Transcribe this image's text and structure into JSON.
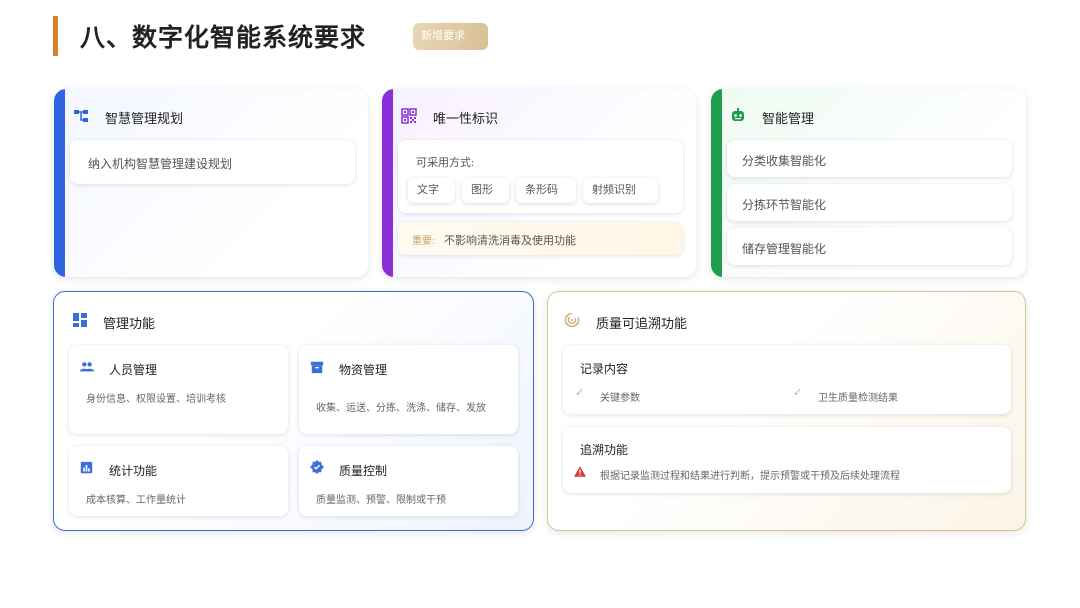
{
  "page": {
    "title": "八、数字化智能系统要求",
    "badge": "新增要求"
  },
  "planning": {
    "title": "智慧管理规划",
    "item": "纳入机构智慧管理建设规划",
    "icon": "hierarchy-icon",
    "accent": "#2f64e0"
  },
  "identity": {
    "title": "唯一性标识",
    "methods_label": "可采用方式:",
    "methods": [
      "文字",
      "图形",
      "条形码",
      "射频识别"
    ],
    "note_prefix": "重要:",
    "note_text": "不影响清洗消毒及使用功能",
    "icon": "qr-code-icon",
    "accent": "#8b2fd9"
  },
  "smart": {
    "title": "智能管理",
    "items": [
      "分类收集智能化",
      "分拣环节智能化",
      "储存管理智能化"
    ],
    "icon": "robot-icon",
    "accent": "#1e9e4a"
  },
  "management": {
    "title": "管理功能",
    "icon": "dashboard-icon",
    "accent": "#3a6fd8",
    "items": [
      {
        "title": "人员管理",
        "desc": "身份信息、权限设置、培训考核",
        "icon": "people-icon"
      },
      {
        "title": "物资管理",
        "desc": "收集、运送、分拣、洗涤、储存、发放",
        "icon": "archive-icon"
      },
      {
        "title": "统计功能",
        "desc": "成本核算、工作量统计",
        "icon": "chart-icon"
      },
      {
        "title": "质量控制",
        "desc": "质量监测、预警、限制或干预",
        "icon": "verified-icon"
      }
    ]
  },
  "trace": {
    "title": "质量可追溯功能",
    "icon": "trace-icon",
    "accent": "#d2b07a",
    "record": {
      "title": "记录内容",
      "items": [
        "关键参数",
        "卫生质量检测结果"
      ]
    },
    "tracing": {
      "title": "追溯功能",
      "desc": "根据记录监测过程和结果进行判断，提示预警或干预及后续处理流程"
    }
  }
}
